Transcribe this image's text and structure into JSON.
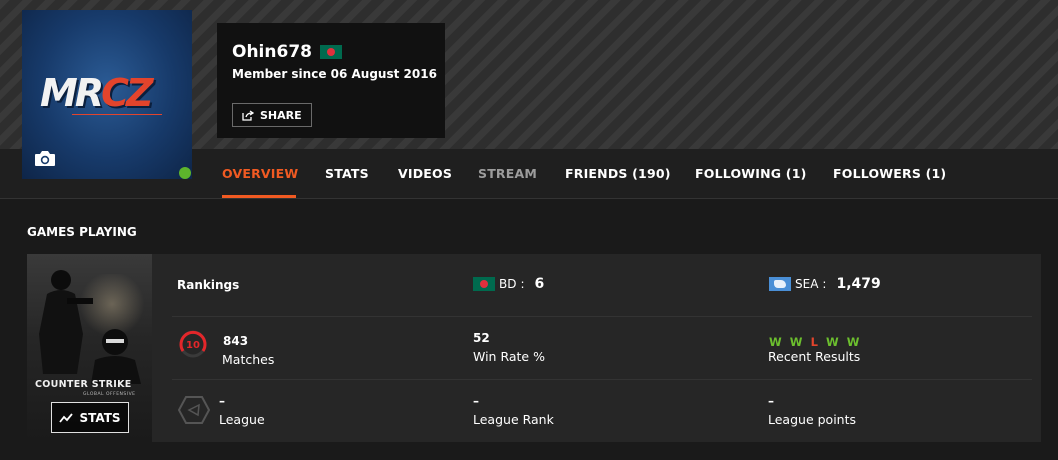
{
  "profile": {
    "username": "Ohin678",
    "member_since": "Member since 06 August 2016",
    "share_label": "SHARE",
    "avatar_logo": {
      "main": "MR",
      "accent": "CZ"
    },
    "status_color": "#5db42c",
    "country_flag": "flag-bangladesh-icon"
  },
  "nav": {
    "tabs": [
      {
        "label": "OVERVIEW",
        "active": true
      },
      {
        "label": "STATS"
      },
      {
        "label": "VIDEOS"
      },
      {
        "label": "STREAM",
        "muted": true
      },
      {
        "label": "FRIENDS (190)"
      },
      {
        "label": "FOLLOWING (1)"
      },
      {
        "label": "FOLLOWERS (1)"
      }
    ]
  },
  "games": {
    "section_title": "GAMES PLAYING",
    "game": {
      "cover_title": "COUNTER STRIKE",
      "cover_subtitle": "GLOBAL OFFENSIVE",
      "stats_button": "STATS",
      "rankings_label": "Rankings",
      "country_rank": {
        "code": "BD",
        "value": "6"
      },
      "region_rank": {
        "code": "SEA",
        "value": "1,479"
      },
      "level": "10",
      "matches": {
        "value": "843",
        "label": "Matches"
      },
      "win_rate": {
        "value": "52",
        "label": "Win Rate %"
      },
      "recent_results": {
        "values": [
          "W",
          "W",
          "L",
          "W",
          "W"
        ],
        "label": "Recent Results"
      },
      "league": {
        "value": "–",
        "label": "League"
      },
      "league_rank": {
        "value": "–",
        "label": "League Rank"
      },
      "league_points": {
        "value": "–",
        "label": "League points"
      }
    }
  },
  "colors": {
    "accent": "#f15a22",
    "win": "#6cbf2e",
    "loss": "#e3442c",
    "level_ring": "#e3262a"
  }
}
